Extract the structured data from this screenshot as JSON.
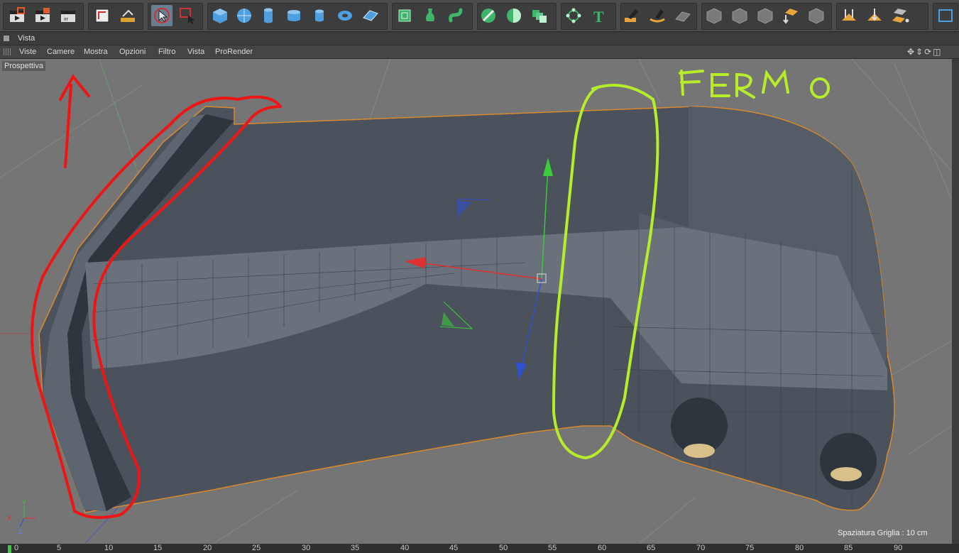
{
  "panel": {
    "title": "Vista"
  },
  "menu": {
    "items": [
      "Viste",
      "Camere",
      "Mostra",
      "Opzioni",
      "Filtro",
      "Vista",
      "ProRender"
    ]
  },
  "viewport": {
    "label": "Prospettiva",
    "grid_spacing": "Spaziatura Griglia : 10 cm",
    "annotation": "FERMO"
  },
  "timeline": {
    "ticks": [
      "0",
      "5",
      "10",
      "15",
      "20",
      "25",
      "30",
      "35",
      "40",
      "45",
      "50",
      "55",
      "60",
      "65",
      "70",
      "75",
      "80",
      "85",
      "90"
    ]
  },
  "toolbar": {
    "icons": [
      "render-view-icon",
      "render-picture-viewer-icon",
      "render-settings-icon",
      "edit-render-settings-icon",
      "undo-view-icon",
      "move-tool-icon",
      "live-selection-icon",
      "cube-icon",
      "sphere-icon",
      "cylinder-icon",
      "tube-icon",
      "disc-icon",
      "torus-icon",
      "plane-icon",
      "subdivision-surface-icon",
      "lathe-icon",
      "hypernurbs-icon",
      "boole-icon",
      "symmetry-icon",
      "cloner-icon",
      "mograph-icon",
      "text-icon",
      "paint-icon",
      "sculpt-icon",
      "grid-icon",
      "camera-icon",
      "light-icon",
      "floor-icon",
      "environment-icon",
      "scene-icon",
      "deformer-icon",
      "render-icon",
      "settings-icon",
      "layout-icon"
    ]
  }
}
